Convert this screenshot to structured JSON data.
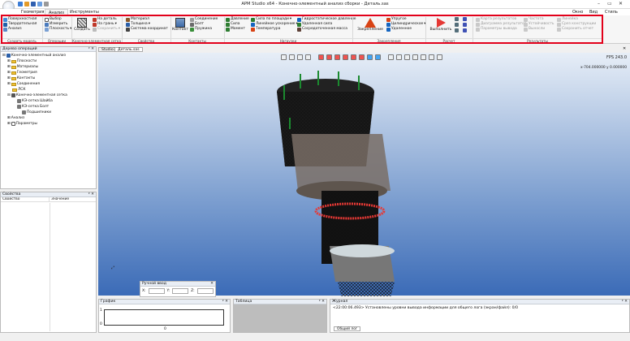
{
  "window": {
    "title": "APM Studio x64 - Конечно-элементный анализ сборки - Деталь.sas",
    "right_menu": [
      "Окно",
      "Вид",
      "Стиль"
    ]
  },
  "ribbon_tabs": [
    "Геометрия",
    "Анализ",
    "Инструменты"
  ],
  "ribbon": {
    "create_model": {
      "items": [
        "Поверхностная",
        "Твердотельная",
        "Анализ"
      ],
      "group": "Создать модель"
    },
    "operations": {
      "items": [
        "Выбор",
        "Измерить",
        "Плоскость"
      ],
      "group": "Операции"
    },
    "mesh": {
      "create": "Создать",
      "items": [
        "На деталь",
        "На грань",
        "Сохранить"
      ],
      "group": "Конечно-элементная сетка"
    },
    "properties": {
      "items": [
        "Материал",
        "Толщина",
        "Система координат"
      ],
      "group": "Свойства"
    },
    "contacts": {
      "contact": "Контакт",
      "items": [
        "Соединение",
        "Болт",
        "Пружина"
      ],
      "group": "Контакты"
    },
    "loads": {
      "col1": [
        "Давление",
        "Сила",
        "Момент"
      ],
      "col2": [
        "Сила по площади",
        "Линейное ускорение",
        "Температура"
      ],
      "col3": [
        "Гидростатическое давление",
        "Удаленная сила",
        "Сосредоточенная масса"
      ],
      "group": "Нагрузки"
    },
    "fixings": {
      "fix": "Закрепление",
      "items": [
        "Упругое",
        "Цилиндрическое",
        "Удаленное"
      ],
      "group": "Закрепления"
    },
    "calc": {
      "run": "Выполнить",
      "group": "Расчет"
    },
    "results": {
      "col1": [
        "Карта результатов",
        "Диаграмма результатов",
        "Параметры вывода"
      ],
      "col2": [
        "Частота",
        "Устойчивость",
        "Выносли"
      ],
      "col3": [
        "Линейка",
        "Срез конструкции",
        "Сохранить отчет"
      ],
      "group": "Результаты"
    }
  },
  "tree_panel": {
    "title": "Дерево операций",
    "root": "Конечно-элементный анализ",
    "items": [
      "Плоскости",
      "Материалы",
      "Геометрия",
      "Контакты",
      "Соединения",
      "ЛСК",
      "Конечно-элементная сетка",
      "КЭ-сетка Шайба",
      "КЭ-сетка Болт",
      "Подшипники",
      "Анализ",
      "Параметры"
    ]
  },
  "props_panel": {
    "title": "Свойства",
    "col1": "Свойство",
    "col2": "Значение"
  },
  "viewport": {
    "tabs": [
      "Studio1",
      "Деталь.sas"
    ],
    "fps": "FPS 243.0",
    "coords": "x-704.000000 y 0.000000"
  },
  "manual_input": {
    "title": "Ручной ввод",
    "labels": [
      "X:",
      "Y:",
      "Z:"
    ]
  },
  "graph": {
    "title": "График",
    "x0": "0",
    "y_top": "1",
    "y_bot": "0"
  },
  "table": {
    "title": "Таблица"
  },
  "log": {
    "title": "Журнал",
    "line": "<22:00:06.493> Установлены уровни вывода информации для общего лога (экран/файл): 0/0",
    "tab": "Общий лог"
  },
  "colors": {
    "highlight": "#e2001a",
    "bg_top": "#e7eef7",
    "bg_bottom": "#3b6bb7"
  }
}
